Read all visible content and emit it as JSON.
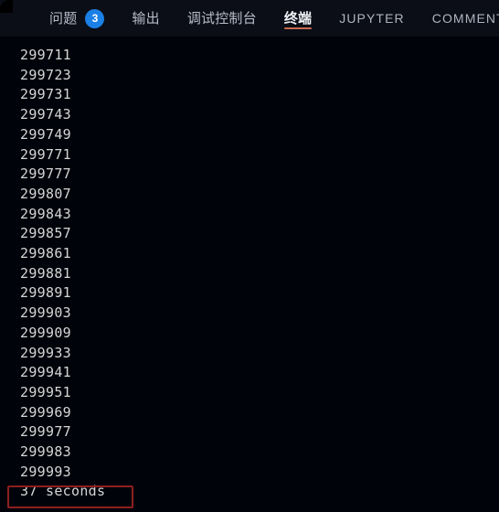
{
  "panel": {
    "tabs": [
      {
        "label": "问题",
        "badge": "3",
        "active": false,
        "script": "cjk"
      },
      {
        "label": "输出",
        "badge": null,
        "active": false,
        "script": "cjk"
      },
      {
        "label": "调试控制台",
        "badge": null,
        "active": false,
        "script": "cjk"
      },
      {
        "label": "终端",
        "badge": null,
        "active": true,
        "script": "cjk"
      },
      {
        "label": "JUPYTER",
        "badge": null,
        "active": false,
        "script": "latin"
      },
      {
        "label": "COMMENTS",
        "badge": null,
        "active": false,
        "script": "latin"
      }
    ]
  },
  "terminal": {
    "lines": [
      "299711",
      "299723",
      "299731",
      "299743",
      "299749",
      "299771",
      "299777",
      "299807",
      "299843",
      "299857",
      "299861",
      "299881",
      "299891",
      "299903",
      "299909",
      "299933",
      "299941",
      "299951",
      "299969",
      "299977",
      "299983",
      "299993"
    ],
    "final_line": "37 seconds"
  },
  "colors": {
    "badge_blue": "#1b80e6",
    "active_underline": "#c96a4f",
    "highlight_border": "#8e1f1f",
    "terminal_bg": "#00030a",
    "tabbar_bg": "#0b0e16",
    "terminal_text": "#d6d6d6"
  }
}
